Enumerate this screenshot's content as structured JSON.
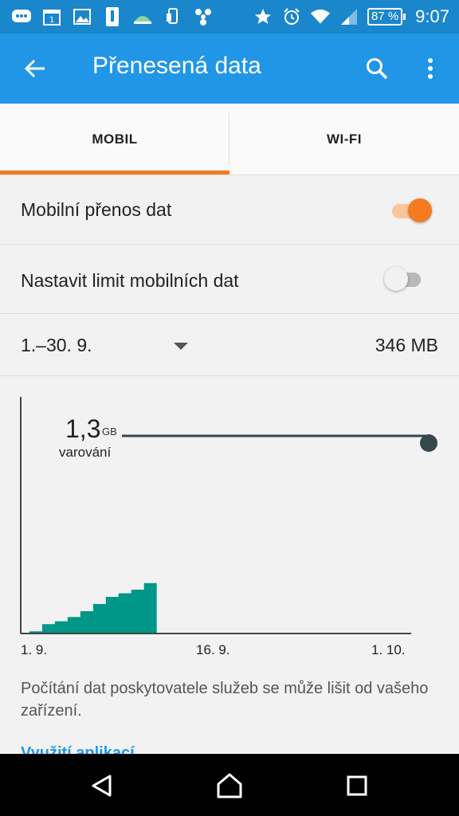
{
  "statusbar": {
    "battery": "87 %",
    "time": "9:07",
    "icons_left": [
      "messages-icon",
      "calendar-icon",
      "gallery-icon",
      "sim-icon",
      "weather-icon",
      "phone-icon",
      "fan-icon"
    ],
    "icons_right": [
      "star-icon",
      "alarm-icon",
      "wifi-icon",
      "signal-icon",
      "battery-icon"
    ]
  },
  "appbar": {
    "title": "Přenesená data"
  },
  "tabs": [
    {
      "label": "MOBIL",
      "selected": true
    },
    {
      "label": "WI-FI",
      "selected": false
    }
  ],
  "settings": {
    "mobile_data_label": "Mobilní přenos dat",
    "mobile_data_enabled": true,
    "limit_label": "Nastavit limit mobilních dat",
    "limit_enabled": false
  },
  "period": {
    "range": "1.–30. 9.",
    "usage": "346 MB"
  },
  "chart": {
    "warning_value": "1,3",
    "warning_unit": "GB",
    "warning_label": "varování",
    "x_labels": [
      "1. 9.",
      "16. 9.",
      "1. 10."
    ]
  },
  "chart_data": {
    "type": "area",
    "x": [
      1,
      2,
      3,
      4,
      5,
      6,
      7,
      8,
      9,
      10
    ],
    "values": [
      10,
      60,
      80,
      110,
      150,
      200,
      250,
      275,
      300,
      346
    ],
    "unit": "MB",
    "xlim": [
      1,
      31
    ],
    "warning_line": 1300,
    "grid": false,
    "accent_color": "#009688"
  },
  "footer": {
    "disclaimer": "Počítání dat poskytovatele služeb se může lišit od vašeho zařízení.",
    "app_usage_link": "Využití aplikací"
  },
  "colors": {
    "statusbar": "#1a86cc",
    "appbar": "#2196e6",
    "accent": "#f47b20",
    "chart_fill": "#009688"
  }
}
